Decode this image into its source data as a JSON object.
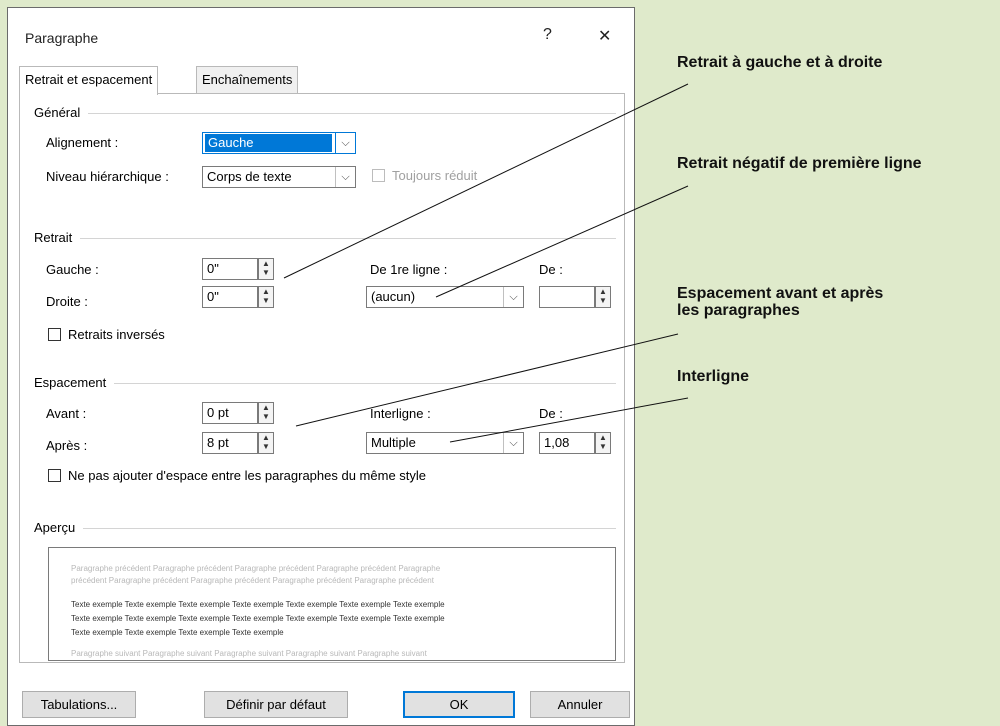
{
  "dialog": {
    "title": "Paragraphe",
    "help_label": "?",
    "close_label": "✕",
    "tabs": [
      {
        "label": "Retrait et espacement"
      },
      {
        "label": "Enchaînements"
      }
    ]
  },
  "general": {
    "heading": "Général",
    "alignment_label": "Alignement :",
    "alignment_value": "Gauche",
    "level_label": "Niveau hiérarchique :",
    "level_value": "Corps de texte",
    "collapsed_label": "Toujours réduit"
  },
  "indent": {
    "heading": "Retrait",
    "left_label": "Gauche :",
    "left_value": "0\"",
    "right_label": "Droite :",
    "right_value": "0\"",
    "first_line_label": "De 1re ligne :",
    "first_line_value": "(aucun)",
    "by_label": "De :",
    "by_value": "",
    "mirror_label": "Retraits inversés"
  },
  "spacing": {
    "heading": "Espacement",
    "before_label": "Avant :",
    "before_value": "0 pt",
    "after_label": "Après :",
    "after_value": "8 pt",
    "line_label": "Interligne :",
    "line_value": "Multiple",
    "at_label": "De :",
    "at_value": "1,08",
    "no_space_label": "Ne pas ajouter d'espace entre les paragraphes du même style"
  },
  "preview": {
    "heading": "Aperçu",
    "prev_1": "Paragraphe précédent Paragraphe précédent Paragraphe précédent Paragraphe précédent Paragraphe",
    "prev_2": "précédent Paragraphe précédent Paragraphe précédent Paragraphe précédent Paragraphe précédent",
    "sample_1": "Texte exemple Texte exemple Texte exemple Texte exemple Texte exemple Texte exemple Texte exemple",
    "sample_2": "Texte exemple Texte exemple Texte exemple Texte exemple Texte exemple Texte exemple Texte exemple",
    "sample_3": "Texte exemple Texte exemple Texte exemple Texte exemple",
    "next_1": "Paragraphe suivant Paragraphe suivant Paragraphe suivant Paragraphe suivant Paragraphe suivant"
  },
  "buttons": {
    "tabs": "Tabulations...",
    "default": "Définir par défaut",
    "ok": "OK",
    "cancel": "Annuler"
  },
  "annotations": {
    "left_right": "Retrait à gauche et à droite",
    "hanging": "Retrait négatif de première ligne",
    "spacing_1": "Espacement avant et après",
    "spacing_2": "les paragraphes",
    "line_spacing": "Interligne"
  },
  "colors": {
    "background": "#dfeacb",
    "selection": "#0078d7",
    "ok_border": "#0078d7"
  }
}
